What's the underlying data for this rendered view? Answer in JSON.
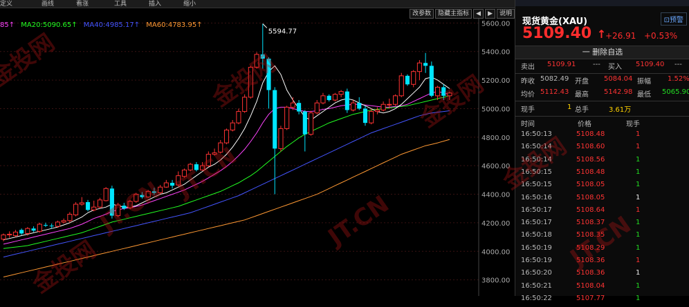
{
  "topbar": {
    "items": [
      "定义",
      "画线",
      "看涨",
      "工具",
      "插入",
      "缩小"
    ]
  },
  "toolbar": [
    "改参数",
    "隐藏主指标",
    "◀",
    "▶",
    "说明"
  ],
  "ma_legend": [
    {
      "text": "85↑",
      "color": "#ff44ff"
    },
    {
      "text": "MA20:5090.65↑",
      "color": "#22ff22"
    },
    {
      "text": "MA40:4985.17↑",
      "color": "#4455ff"
    },
    {
      "text": "MA60:4783.95↑",
      "color": "#ff9933"
    }
  ],
  "chart_data": {
    "type": "candlestick",
    "ylim": [
      3750,
      5650
    ],
    "ticks": [
      {
        "value": 5600,
        "label": "5600.00"
      },
      {
        "value": 5400,
        "label": "5400.00"
      },
      {
        "value": 5200,
        "label": "5200.00"
      },
      {
        "value": 5000,
        "label": "5000.00"
      },
      {
        "value": 4800,
        "label": "4800.00"
      },
      {
        "value": 4600,
        "label": "4600.00"
      },
      {
        "value": 4400,
        "label": "4400.00"
      },
      {
        "value": 4200,
        "label": "4200.00"
      },
      {
        "value": 4000,
        "label": "4000.00"
      },
      {
        "value": 3800,
        "label": "3800.00"
      }
    ],
    "high_annotation": {
      "value": 5594.77,
      "label": "5594.77"
    },
    "candles": [
      [
        4085,
        4115,
        4070,
        4125
      ],
      [
        4115,
        4120,
        4095,
        4140
      ],
      [
        4110,
        4135,
        4100,
        4150
      ],
      [
        4150,
        4125,
        4115,
        4160
      ],
      [
        4125,
        4160,
        4110,
        4170
      ],
      [
        4160,
        4145,
        4135,
        4175
      ],
      [
        4140,
        4190,
        4130,
        4200
      ],
      [
        4185,
        4180,
        4170,
        4200
      ],
      [
        4180,
        4175,
        4160,
        4195
      ],
      [
        4175,
        4205,
        4165,
        4215
      ],
      [
        4205,
        4215,
        4195,
        4230
      ],
      [
        4215,
        4260,
        4200,
        4275
      ],
      [
        4255,
        4330,
        4245,
        4345
      ],
      [
        4330,
        4340,
        4320,
        4380
      ],
      [
        4345,
        4290,
        4280,
        4360
      ],
      [
        4290,
        4310,
        4280,
        4355
      ],
      [
        4310,
        4360,
        4300,
        4375
      ],
      [
        4355,
        4440,
        4350,
        4450
      ],
      [
        4440,
        4250,
        4230,
        4460
      ],
      [
        4250,
        4325,
        4240,
        4340
      ],
      [
        4320,
        4300,
        4290,
        4340
      ],
      [
        4305,
        4350,
        4295,
        4360
      ],
      [
        4350,
        4400,
        4340,
        4410
      ],
      [
        4395,
        4380,
        4370,
        4415
      ],
      [
        4380,
        4420,
        4375,
        4430
      ],
      [
        4420,
        4410,
        4395,
        4445
      ],
      [
        4410,
        4450,
        4400,
        4465
      ],
      [
        4450,
        4480,
        4445,
        4500
      ],
      [
        4480,
        4460,
        4440,
        4500
      ],
      [
        4465,
        4530,
        4455,
        4560
      ],
      [
        4525,
        4570,
        4515,
        4580
      ],
      [
        4570,
        4610,
        4560,
        4620
      ],
      [
        4610,
        4570,
        4560,
        4625
      ],
      [
        4570,
        4600,
        4565,
        4625
      ],
      [
        4600,
        4680,
        4590,
        4700
      ],
      [
        4680,
        4690,
        4670,
        4720
      ],
      [
        4695,
        4760,
        4685,
        4780
      ],
      [
        4760,
        4850,
        4750,
        4860
      ],
      [
        4850,
        4900,
        4840,
        4920
      ],
      [
        4900,
        4980,
        4890,
        5000
      ],
      [
        4980,
        5080,
        4970,
        5100
      ],
      [
        5080,
        5290,
        5070,
        5300
      ],
      [
        5290,
        5380,
        5280,
        5395
      ],
      [
        5380,
        5350,
        5280,
        5594.77
      ],
      [
        5350,
        5130,
        5000,
        5360
      ],
      [
        5130,
        4720,
        4400,
        5150
      ],
      [
        4720,
        4860,
        4700,
        4880
      ],
      [
        4860,
        5010,
        4850,
        5020
      ],
      [
        5010,
        5040,
        4990,
        5080
      ],
      [
        5040,
        4980,
        4960,
        5060
      ],
      [
        4980,
        4820,
        4700,
        4990
      ],
      [
        4820,
        4970,
        4810,
        4985
      ],
      [
        4970,
        5040,
        4960,
        5060
      ],
      [
        5040,
        5090,
        5030,
        5110
      ],
      [
        5090,
        5060,
        5050,
        5100
      ],
      [
        5060,
        5100,
        5050,
        5110
      ],
      [
        5100,
        5120,
        5080,
        5130
      ],
      [
        5120,
        4990,
        4970,
        5140
      ],
      [
        4990,
        5040,
        4980,
        5060
      ],
      [
        5040,
        5000,
        4990,
        5080
      ],
      [
        5000,
        4900,
        4880,
        5020
      ],
      [
        4900,
        4980,
        4890,
        5000
      ],
      [
        4980,
        4990,
        4960,
        5010
      ],
      [
        4990,
        5030,
        4980,
        5050
      ],
      [
        5030,
        5030,
        5000,
        5070
      ],
      [
        5030,
        5090,
        5020,
        5100
      ],
      [
        5090,
        5230,
        5080,
        5250
      ],
      [
        5230,
        5170,
        5160,
        5240
      ],
      [
        5170,
        5260,
        5150,
        5270
      ],
      [
        5260,
        5320,
        5200,
        5340
      ],
      [
        5320,
        5300,
        5250,
        5390
      ],
      [
        5300,
        5090,
        5080,
        5330
      ],
      [
        5090,
        5150,
        5060,
        5160
      ],
      [
        5150,
        5090,
        5060,
        5170
      ],
      [
        5090,
        5109.4,
        5060,
        5120
      ]
    ],
    "ma5": [
      4080,
      4090,
      4100,
      4110,
      4120,
      4130,
      4140,
      4150,
      4160,
      4170,
      4185,
      4200,
      4220,
      4240,
      4270,
      4290,
      4300,
      4310,
      4330,
      4320,
      4310,
      4310,
      4320,
      4340,
      4360,
      4380,
      4400,
      4410,
      4430,
      4450,
      4470,
      4500,
      4530,
      4560,
      4590,
      4610,
      4640,
      4680,
      4730,
      4790,
      4860,
      4950,
      5050,
      5180,
      5260,
      5300,
      5240,
      5130,
      5060,
      5000,
      4940,
      4920,
      4950,
      4980,
      5010,
      5040,
      5060,
      5070,
      5060,
      5040,
      5020,
      5000,
      4980,
      4970,
      4980,
      5000,
      5030,
      5070,
      5110,
      5150,
      5210,
      5220,
      5200,
      5170,
      5140
    ],
    "ma10": [
      4050,
      4060,
      4070,
      4080,
      4090,
      4100,
      4110,
      4120,
      4130,
      4140,
      4150,
      4160,
      4175,
      4190,
      4210,
      4230,
      4245,
      4260,
      4280,
      4290,
      4300,
      4305,
      4315,
      4325,
      4340,
      4355,
      4370,
      4385,
      4400,
      4415,
      4430,
      4450,
      4470,
      4490,
      4515,
      4540,
      4565,
      4595,
      4630,
      4670,
      4715,
      4770,
      4830,
      4900,
      4960,
      5000,
      5010,
      5010,
      5000,
      4990,
      4980,
      4980,
      4985,
      4995,
      5000,
      5010,
      5020,
      5025,
      5030,
      5030,
      5025,
      5020,
      5015,
      5010,
      5010,
      5015,
      5020,
      5030,
      5050,
      5070,
      5090,
      5110,
      5120,
      5110,
      5100
    ],
    "ma20": [
      4020,
      4025,
      4030,
      4035,
      4040,
      4050,
      4060,
      4070,
      4080,
      4090,
      4100,
      4110,
      4120,
      4130,
      4145,
      4160,
      4175,
      4190,
      4205,
      4215,
      4225,
      4235,
      4245,
      4255,
      4265,
      4275,
      4285,
      4295,
      4305,
      4315,
      4330,
      4345,
      4360,
      4375,
      4390,
      4405,
      4420,
      4440,
      4460,
      4480,
      4505,
      4530,
      4560,
      4595,
      4630,
      4665,
      4700,
      4735,
      4765,
      4795,
      4820,
      4840,
      4860,
      4880,
      4900,
      4915,
      4930,
      4945,
      4960,
      4970,
      4980,
      4990,
      4995,
      5000,
      5005,
      5010,
      5015,
      5020,
      5030,
      5040,
      5050,
      5060,
      5070,
      5080,
      5090.65
    ],
    "ma40": [
      3960,
      3970,
      3980,
      3990,
      4000,
      4010,
      4020,
      4030,
      4040,
      4050,
      4060,
      4070,
      4080,
      4090,
      4100,
      4110,
      4120,
      4130,
      4140,
      4150,
      4160,
      4170,
      4180,
      4190,
      4200,
      4210,
      4220,
      4230,
      4240,
      4250,
      4260,
      4270,
      4285,
      4300,
      4315,
      4330,
      4345,
      4360,
      4375,
      4390,
      4410,
      4430,
      4450,
      4470,
      4490,
      4510,
      4530,
      4550,
      4570,
      4590,
      4610,
      4630,
      4650,
      4670,
      4690,
      4710,
      4730,
      4750,
      4770,
      4790,
      4810,
      4830,
      4845,
      4860,
      4875,
      4890,
      4905,
      4920,
      4935,
      4950,
      4960,
      4970,
      4975,
      4980,
      4985.17
    ],
    "ma60": [
      3820,
      3830,
      3840,
      3850,
      3860,
      3870,
      3880,
      3890,
      3900,
      3910,
      3920,
      3930,
      3940,
      3950,
      3960,
      3970,
      3980,
      3990,
      4000,
      4010,
      4020,
      4030,
      4040,
      4050,
      4060,
      4070,
      4080,
      4090,
      4100,
      4110,
      4120,
      4130,
      4140,
      4150,
      4160,
      4170,
      4180,
      4190,
      4200,
      4210,
      4220,
      4235,
      4250,
      4265,
      4280,
      4295,
      4310,
      4325,
      4340,
      4355,
      4370,
      4385,
      4400,
      4420,
      4440,
      4460,
      4480,
      4500,
      4520,
      4540,
      4560,
      4580,
      4600,
      4620,
      4640,
      4660,
      4680,
      4695,
      4710,
      4725,
      4740,
      4750,
      4760,
      4772,
      4783.95
    ]
  },
  "quote": {
    "title": "现货黄金(XAU)",
    "alert": "⊡预警",
    "price": "5109.40",
    "arrow": "↑",
    "change": "+26.91",
    "pct": "+0.53%",
    "delete_btn": "一 删除自选",
    "ask_label": "卖出",
    "ask": "5109.91",
    "ask_vol": "---",
    "bid_label": "买入",
    "bid": "5109.40",
    "bid_vol": "---",
    "prev_label": "昨收",
    "prev": "5082.49",
    "open_label": "开盘",
    "open": "5084.04",
    "amp_label": "振幅",
    "amp": "1.52%",
    "avg_label": "均价",
    "avg": "5112.43",
    "high_label": "最高",
    "high": "5142.98",
    "low_label": "最低",
    "low": "5065.90",
    "cur_label": "现手",
    "cur": "1",
    "total_label": "总手",
    "total": "3.61万"
  },
  "ticks_header": {
    "time": "时间",
    "price": "价格",
    "vol": "现手"
  },
  "ticks": [
    {
      "time": "16:50:13",
      "price": "5108.48",
      "vol": "1",
      "vc": "red"
    },
    {
      "time": "16:50:14",
      "price": "5108.60",
      "vol": "1",
      "vc": "red"
    },
    {
      "time": "16:50:14",
      "price": "5108.56",
      "vol": "1",
      "vc": "green"
    },
    {
      "time": "16:50:15",
      "price": "5108.48",
      "vol": "1",
      "vc": "green"
    },
    {
      "time": "16:50:15",
      "price": "5108.05",
      "vol": "1",
      "vc": "green"
    },
    {
      "time": "16:50:16",
      "price": "5108.05",
      "vol": "1",
      "vc": "white"
    },
    {
      "time": "16:50:17",
      "price": "5108.64",
      "vol": "1",
      "vc": "red"
    },
    {
      "time": "16:50:17",
      "price": "5108.37",
      "vol": "1",
      "vc": "green"
    },
    {
      "time": "16:50:18",
      "price": "5108.35",
      "vol": "1",
      "vc": "green"
    },
    {
      "time": "16:50:19",
      "price": "5108.29",
      "vol": "1",
      "vc": "green"
    },
    {
      "time": "16:50:19",
      "price": "5108.36",
      "vol": "1",
      "vc": "red"
    },
    {
      "time": "16:50:20",
      "price": "5108.36",
      "vol": "1",
      "vc": "white"
    },
    {
      "time": "16:50:21",
      "price": "5108.04",
      "vol": "1",
      "vc": "green"
    },
    {
      "time": "16:50:22",
      "price": "5107.77",
      "vol": "1",
      "vc": "green"
    }
  ],
  "watermark": "金投网",
  "watermark_en": "JT.CN",
  "colors": {
    "up": "#ff3333",
    "down": "#00e5ff",
    "ma5": "#ffffff",
    "ma10": "#ff44ff",
    "ma20": "#22ff22",
    "ma40": "#4455ff",
    "ma60": "#ff9933",
    "grid": "#3a1212"
  }
}
